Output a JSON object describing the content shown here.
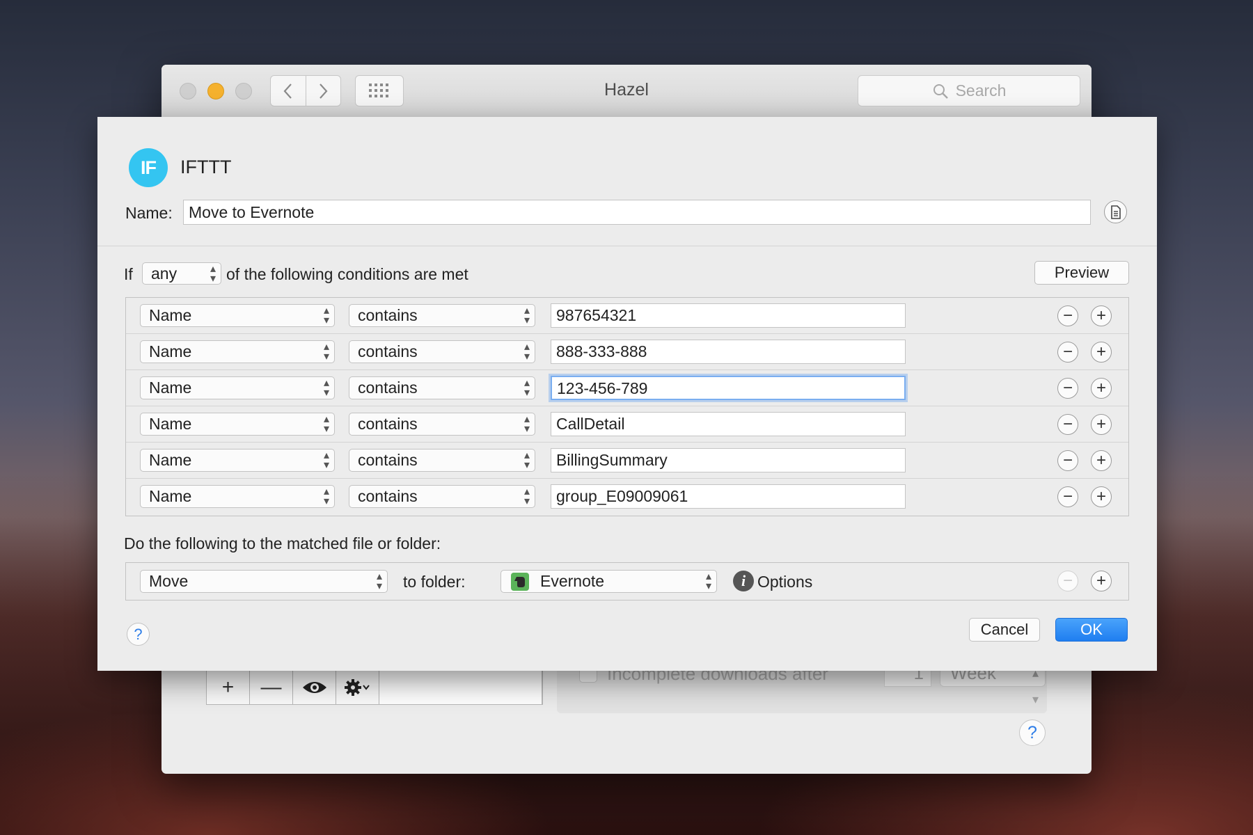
{
  "hazel_window": {
    "title": "Hazel",
    "search_placeholder": "Search",
    "toolbar": {
      "add_label": "+",
      "remove_label": "—"
    },
    "options": {
      "incomplete_label": "Incomplete downloads after",
      "incomplete_count": "1",
      "incomplete_unit": "Week"
    },
    "help_label": "?"
  },
  "sheet": {
    "app_logo_text": "IF",
    "app_name": "IFTTT",
    "name_label": "Name:",
    "name_value": "Move to Evernote",
    "if_label": "If",
    "match_mode": "any",
    "conditions_suffix": "of the following conditions are met",
    "preview_label": "Preview",
    "conditions": [
      {
        "attribute": "Name",
        "operator": "contains",
        "value": "987654321"
      },
      {
        "attribute": "Name",
        "operator": "contains",
        "value": "888-333-888"
      },
      {
        "attribute": "Name",
        "operator": "contains",
        "value": "123-456-789"
      },
      {
        "attribute": "Name",
        "operator": "contains",
        "value": "CallDetail"
      },
      {
        "attribute": "Name",
        "operator": "contains",
        "value": "BillingSummary"
      },
      {
        "attribute": "Name",
        "operator": "contains",
        "value": "group_E09009061"
      }
    ],
    "row_minus": "−",
    "row_plus": "+",
    "actions_label": "Do the following to the matched file or folder:",
    "action": {
      "verb": "Move",
      "to_folder_label": "to folder:",
      "folder": "Evernote",
      "info_glyph": "i",
      "options_label": "Options"
    },
    "help_label": "?",
    "cancel_label": "Cancel",
    "ok_label": "OK"
  },
  "colors": {
    "accent": "#1f7ef0",
    "ifttt_blue": "#34c5f1",
    "focus_ring": "#7aaef0",
    "evernote_green": "#5bb35a"
  }
}
